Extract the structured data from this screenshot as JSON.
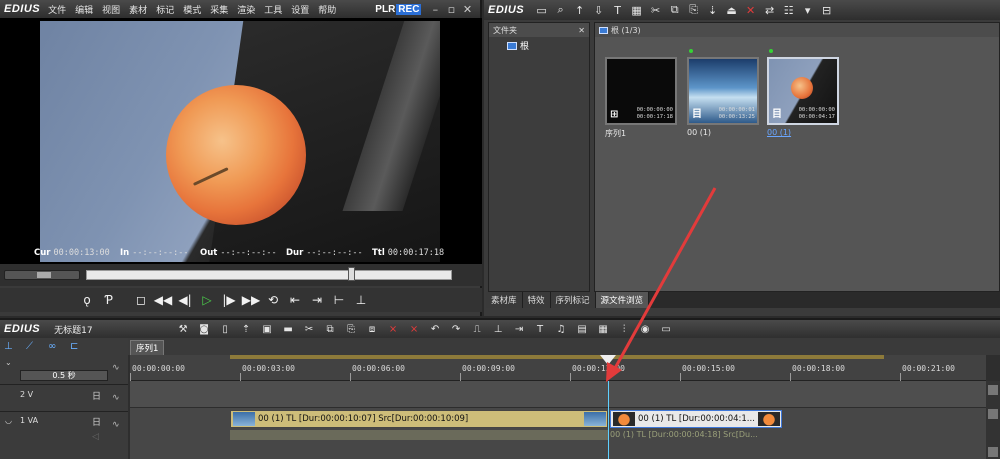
{
  "player": {
    "logo": "EDIUS",
    "menu": [
      "文件",
      "编辑",
      "视图",
      "素材",
      "标记",
      "模式",
      "采集",
      "渲染",
      "工具",
      "设置",
      "帮助"
    ],
    "plr": "PLR",
    "rec": "REC",
    "timecodes": {
      "cur_label": "Cur",
      "cur": "00:00:13:00",
      "in_label": "In",
      "in": "--:--:--:--",
      "out_label": "Out",
      "out": "--:--:--:--",
      "dur_label": "Dur",
      "dur": "--:--:--:--",
      "ttl_label": "Ttl",
      "ttl": "00:00:17:18"
    },
    "controls": [
      "stop",
      "rewind",
      "prev-frame",
      "play",
      "next-frame",
      "fast-forward",
      "loop",
      "set-in-out",
      "overwrite",
      "insert",
      "mark"
    ]
  },
  "bin": {
    "logo": "EDIUS",
    "folder_panel": {
      "title": "文件夹",
      "root": "根"
    },
    "clip_panel": {
      "path": "根 (1/3)"
    },
    "clips": [
      {
        "name": "序列1",
        "tc1": "00:00:00:00",
        "tc2": "00:00:17:18",
        "type_glyph": "⊞",
        "thumb": "black",
        "selected": false
      },
      {
        "name": "00 (1)",
        "tc1": "00:00:00:01",
        "tc2": "00:00:13:25",
        "type_glyph": "目",
        "thumb": "sky",
        "selected": false
      },
      {
        "name": "00 (1)",
        "tc1": "00:00:00:00",
        "tc2": "00:00:04:17",
        "type_glyph": "目",
        "thumb": "apple",
        "selected": true
      }
    ],
    "tabs": [
      "素材库",
      "特效",
      "序列标记",
      "源文件浏览"
    ],
    "active_tab": "源文件浏览"
  },
  "timeline": {
    "logo": "EDIUS",
    "project_title": "无标题17",
    "sequence_tab": "序列1",
    "speed": "0.5 秒",
    "ruler_ticks": [
      "00:00:00:00",
      "00:00:03:00",
      "00:00:06:00",
      "00:00:09:00",
      "00:00:12:00",
      "00:00:15:00",
      "00:00:18:00",
      "00:00:21:00"
    ],
    "tracks": [
      {
        "label": "2 V"
      },
      {
        "label": "1 VA"
      }
    ],
    "clip1": "00 (1)  TL [Dur:00:00:10:07]  Src[Dur:00:00:10:09]",
    "clip2": "00 (1)  TL [Dur:00:00:04:1...",
    "audio2": "00 (1)  TL [Dur:00:00:04:18]  Src[Du..."
  },
  "colors": {
    "accent": "#2b6fd6",
    "play": "#4bd24b",
    "clip": "#cdbd79",
    "cursor": "#5fd0ff",
    "annotation_arrow": "#e23b3b"
  }
}
